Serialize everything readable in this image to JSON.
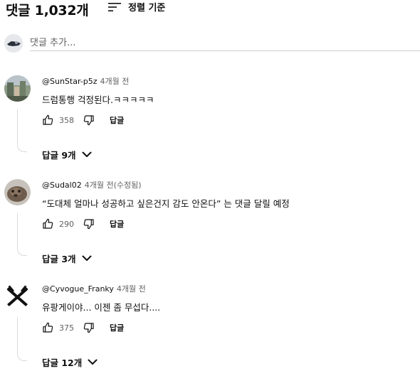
{
  "header": {
    "count_label": "댓글 1,032개",
    "sort_label": "정렬 기준",
    "sort_icon": "sort-icon"
  },
  "add_comment": {
    "placeholder": "댓글 추가..."
  },
  "comments": [
    {
      "author": "@SunStar-p5z",
      "time": "4개월 전",
      "text": "드럼통행 걱정된다.ㅋㅋㅋㅋㅋ",
      "likes": "358",
      "reply_label": "답글",
      "replies_label": "답글 9개"
    },
    {
      "author": "@Sudal02",
      "time": "4개월 전(수정됨)",
      "text": "“도대체 얼마나 성공하고 싶은건지 감도 안온다” 는 댓글 달릴 예정",
      "likes": "290",
      "reply_label": "답글",
      "replies_label": "답글 3개"
    },
    {
      "author": "@Cyvogue_Franky",
      "time": "4개월 전",
      "text": "유팡게이야... 이젠 좀 무섭다....",
      "likes": "375",
      "reply_label": "답글",
      "replies_label": "답글 12개"
    }
  ]
}
